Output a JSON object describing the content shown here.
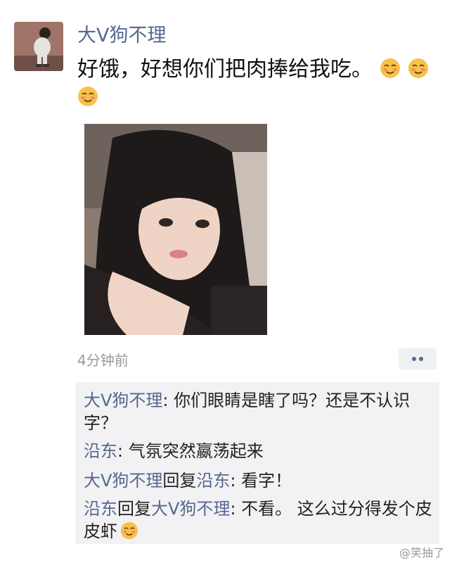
{
  "post": {
    "username": "大V狗不理",
    "text": "好饿，好想你们把肉捧给我吃。",
    "emoji_icon": "blushing-smile-emoji",
    "timestamp": "4分钟前",
    "more_button_icon": "ellipsis-icon"
  },
  "comments": [
    {
      "name": "大V狗不理",
      "sep": ": ",
      "text": "你们眼睛是瞎了吗？还是不认识字？"
    },
    {
      "name": "沿东",
      "sep": ": ",
      "text": "气氛突然嬴荡起来"
    },
    {
      "name": "大V狗不理",
      "reply_word": "回复",
      "reply_to": "沿东",
      "sep": ": ",
      "text": "看字！"
    },
    {
      "name": "沿东",
      "reply_word": "回复",
      "reply_to": "大V狗不理",
      "sep": ": ",
      "text": "不看。 这么过分得发个皮皮虾"
    }
  ],
  "watermark": "@笑抽了",
  "colors": {
    "name_blue": "#56688f",
    "comment_bg": "#f2f2f4",
    "timestamp_gray": "#9a9a9a"
  }
}
